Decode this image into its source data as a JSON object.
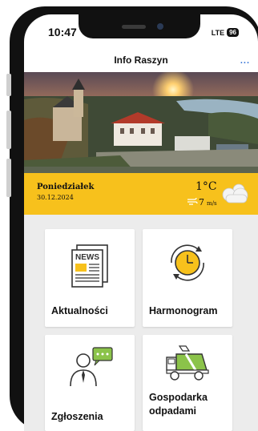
{
  "status_bar": {
    "time": "10:47",
    "network": "LTE",
    "battery": "96"
  },
  "header": {
    "title": "Info Raszyn",
    "menu": "..."
  },
  "weather": {
    "day": "Poniedziałek",
    "date": "30.12.2024",
    "temperature": "1°C",
    "wind_speed": "7",
    "wind_unit": "m/s",
    "condition_icon": "cloud-icon",
    "accent": "#f7c11c"
  },
  "tiles": [
    {
      "label": "Aktualności",
      "icon": "newspaper-icon"
    },
    {
      "label": "Harmonogram",
      "icon": "clock-icon"
    },
    {
      "label": "Zgłoszenia",
      "icon": "person-chat-icon"
    },
    {
      "label_line1": "Gospodarka",
      "label_line2": "odpadami",
      "icon": "garbage-truck-icon"
    }
  ],
  "news_icon_text": "NEWS",
  "colors": {
    "accent": "#f7c11c",
    "link": "#2f6fd6",
    "tile_bg": "#ffffff",
    "grid_bg": "#ececec"
  }
}
